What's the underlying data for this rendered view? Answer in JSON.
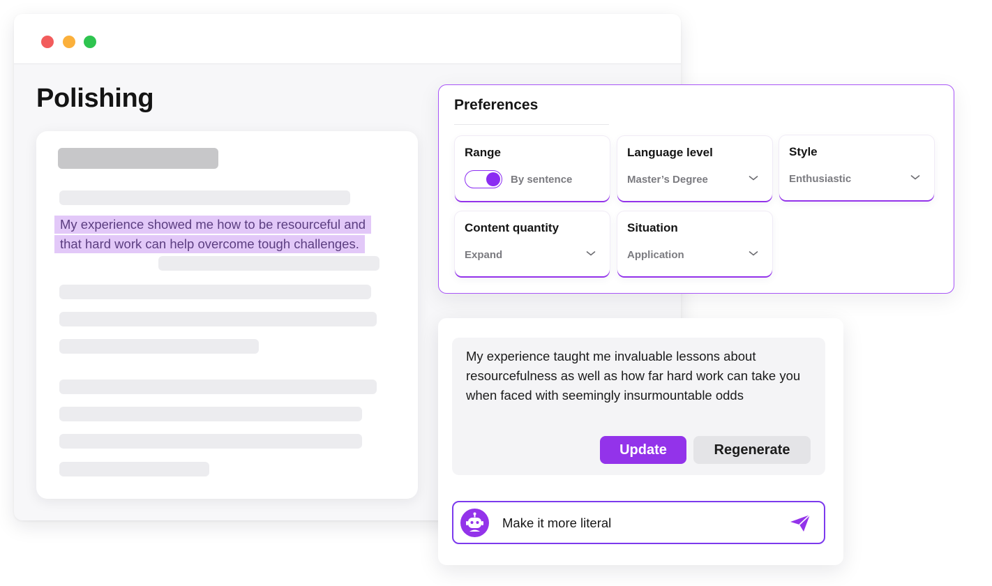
{
  "window": {
    "traffic_lights": {
      "close_color": "#f25c5c",
      "minimize_color": "#fbb03b",
      "maximize_color": "#2ec44f"
    },
    "page_title": "Polishing"
  },
  "document": {
    "selected_text": "My experience showed me how to be resourceful and that hard work can help overcome tough challenges."
  },
  "preferences": {
    "title": "Preferences",
    "range": {
      "label": "Range",
      "toggle_on": true,
      "value": "By sentence"
    },
    "language_level": {
      "label": "Language level",
      "value": "Master’s Degree"
    },
    "style": {
      "label": "Style",
      "value": "Enthusiastic"
    },
    "content_quantity": {
      "label": "Content quantity",
      "value": "Expand"
    },
    "situation": {
      "label": "Situation",
      "value": "Application"
    }
  },
  "result": {
    "text": "My experience taught me invaluable lessons about resourcefulness as well as how far hard work can take you when faced with seemingly insurmountable odds",
    "update_label": "Update",
    "regenerate_label": "Regenerate"
  },
  "chat": {
    "input_value": "Make it more literal",
    "avatar_icon": "robot-icon",
    "send_icon": "paper-plane-icon"
  },
  "colors": {
    "accent": "#9333ea",
    "highlight": "#e2c8f8"
  }
}
